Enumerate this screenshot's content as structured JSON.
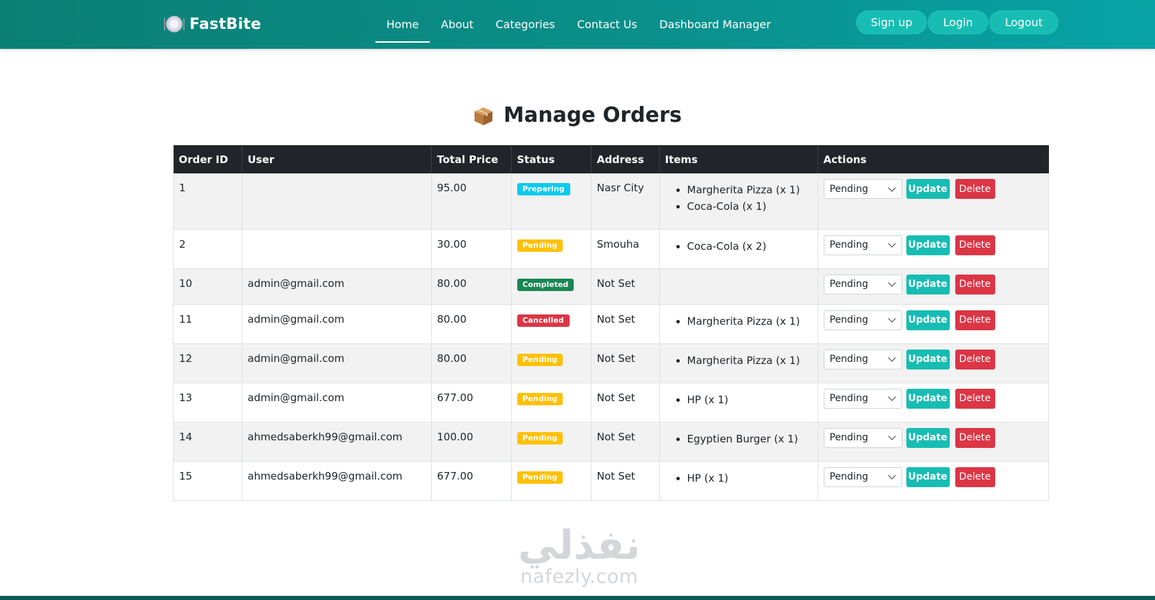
{
  "brand": {
    "name": "FastBite",
    "icon": "plate-cutlery-icon"
  },
  "nav": {
    "links": [
      {
        "label": "Home",
        "active": true
      },
      {
        "label": "About",
        "active": false
      },
      {
        "label": "Categories",
        "active": false
      },
      {
        "label": "Contact Us",
        "active": false
      },
      {
        "label": "Dashboard Manager",
        "active": false
      }
    ],
    "auth": [
      "Sign up",
      "Login",
      "Logout"
    ]
  },
  "page": {
    "title": "Manage Orders",
    "title_icon": "package-box-icon"
  },
  "table": {
    "headers": [
      "Order ID",
      "User",
      "Total Price",
      "Status",
      "Address",
      "Items",
      "Actions"
    ],
    "rows": [
      {
        "id": "1",
        "user": "",
        "total": "95.00",
        "status": "Preparing",
        "status_type": "preparing",
        "address": "Nasr City",
        "items": [
          "Margherita Pizza (x 1)",
          "Coca-Cola (x 1)"
        ],
        "select": "Pending"
      },
      {
        "id": "2",
        "user": "",
        "total": "30.00",
        "status": "Pending",
        "status_type": "pending",
        "address": "Smouha",
        "items": [
          "Coca-Cola (x 2)"
        ],
        "select": "Pending"
      },
      {
        "id": "10",
        "user": "admin@gmail.com",
        "total": "80.00",
        "status": "Completed",
        "status_type": "completed",
        "address": "Not Set",
        "items": [],
        "select": "Pending"
      },
      {
        "id": "11",
        "user": "admin@gmail.com",
        "total": "80.00",
        "status": "Cancelled",
        "status_type": "cancelled",
        "address": "Not Set",
        "items": [
          "Margherita Pizza (x 1)"
        ],
        "select": "Pending"
      },
      {
        "id": "12",
        "user": "admin@gmail.com",
        "total": "80.00",
        "status": "Pending",
        "status_type": "pending",
        "address": "Not Set",
        "items": [
          "Margherita Pizza (x 1)"
        ],
        "select": "Pending"
      },
      {
        "id": "13",
        "user": "admin@gmail.com",
        "total": "677.00",
        "status": "Pending",
        "status_type": "pending",
        "address": "Not Set",
        "items": [
          "HP (x 1)"
        ],
        "select": "Pending"
      },
      {
        "id": "14",
        "user": "ahmedsaberkh99@gmail.com",
        "total": "100.00",
        "status": "Pending",
        "status_type": "pending",
        "address": "Not Set",
        "items": [
          "Egyptien Burger (x 1)"
        ],
        "select": "Pending"
      },
      {
        "id": "15",
        "user": "ahmedsaberkh99@gmail.com",
        "total": "677.00",
        "status": "Pending",
        "status_type": "pending",
        "address": "Not Set",
        "items": [
          "HP (x 1)"
        ],
        "select": "Pending"
      }
    ],
    "update_label": "Update",
    "delete_label": "Delete"
  },
  "watermark": {
    "arabic": "نفذلي",
    "latin": "nafezly.com"
  },
  "colors": {
    "navbar_start": "#0b7f74",
    "navbar_end": "#08a3a6",
    "accent": "#17bdb3",
    "table_header": "#212529",
    "badge_preparing": "#0dcaf0",
    "badge_pending": "#ffc107",
    "badge_completed": "#198754",
    "badge_cancelled": "#dc3545",
    "delete": "#dc3545"
  }
}
